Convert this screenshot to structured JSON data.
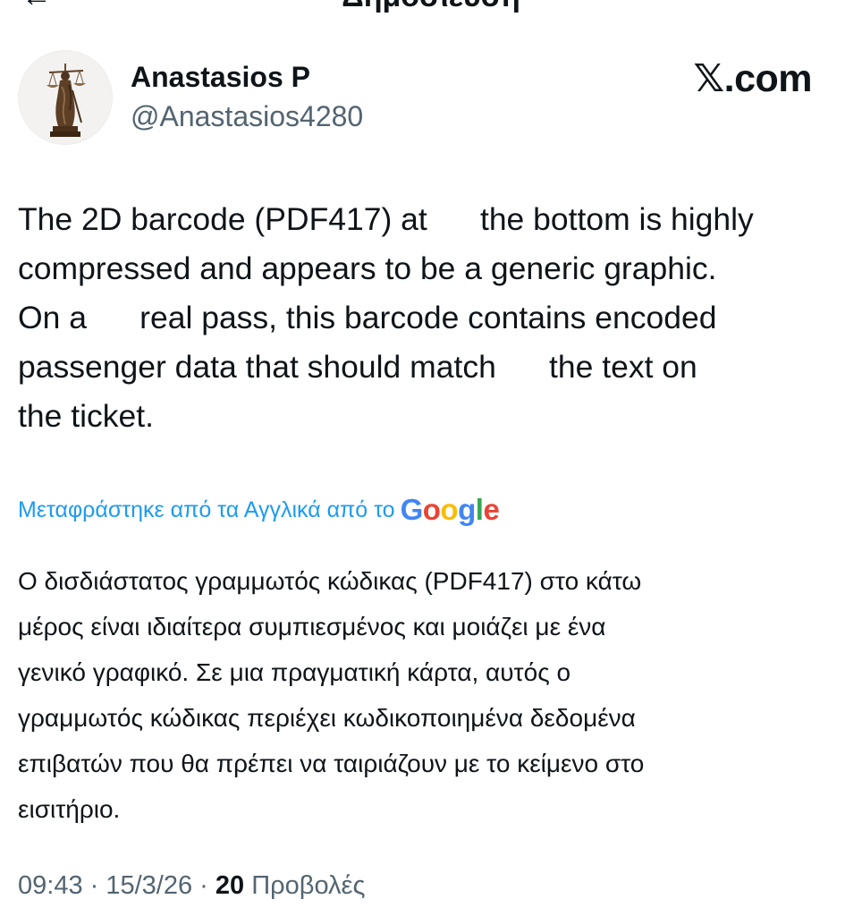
{
  "header": {
    "title": "Δημοσίευση",
    "back_icon": "arrow-left-icon"
  },
  "author": {
    "name": "Anastasios P",
    "handle": "@Anastasios4280",
    "avatar_icon": "lady-justice-statue-avatar"
  },
  "brand": {
    "text": "𝕏.com"
  },
  "tweet": {
    "text": "The 2D barcode (PDF417) at      the bottom is highly\ncompressed and appears to be a generic graphic.\nOn a      real pass, this barcode contains encoded\npassenger data that should match      the text on\nthe ticket."
  },
  "translation": {
    "label": "Μεταφράστηκε από τα Αγγλικά από το",
    "provider": "Google",
    "text": "Ο δισδιάστατος γραμμωτός κώδικας (PDF417) στο κάτω\nμέρος είναι ιδιαίτερα συμπιεσμένος και μοιάζει με ένα\nγενικό γραφικό. Σε μια πραγματική κάρτα, αυτός ο\nγραμμωτός κώδικας περιέχει κωδικοποιημένα δεδομένα\nεπιβατών που θα πρέπει να ταιριάζουν με το κείμενο στο\nεισιτήριο."
  },
  "meta": {
    "time": "09:43",
    "separator": " · ",
    "date": "15/3/26",
    "views_count": "20",
    "views_label": " Προβολές"
  },
  "colors": {
    "link_blue": "#1d9bf0",
    "secondary_text": "#536471",
    "primary_text": "#0f1419"
  }
}
